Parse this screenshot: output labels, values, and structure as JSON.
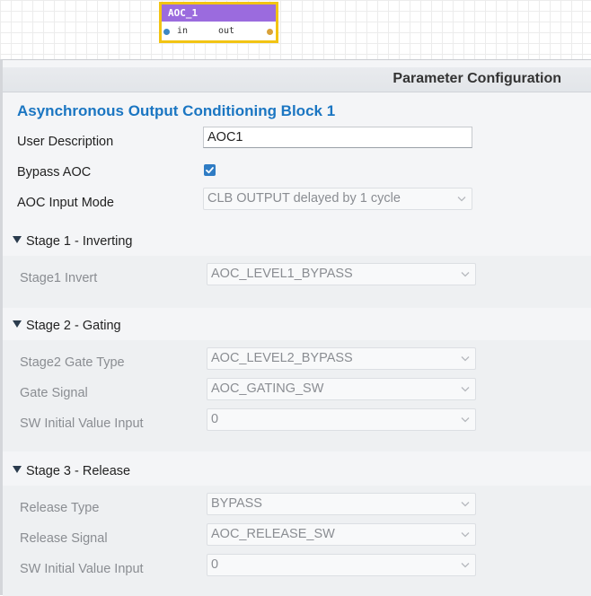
{
  "block": {
    "name": "AOC_1",
    "port_in": "in",
    "port_out": "out"
  },
  "panel": {
    "title": "Parameter Configuration",
    "section_title": "Asynchronous Output Conditioning Block 1",
    "user_description_label": "User Description",
    "user_description_value": "AOC1",
    "bypass_label": "Bypass AOC",
    "bypass_checked": true,
    "input_mode_label": "AOC Input Mode",
    "input_mode_value": "CLB OUTPUT delayed by 1 cycle"
  },
  "stage1": {
    "title": "Stage 1 - Inverting",
    "invert_label": "Stage1 Invert",
    "invert_value": "AOC_LEVEL1_BYPASS"
  },
  "stage2": {
    "title": "Stage 2 - Gating",
    "gate_type_label": "Stage2 Gate Type",
    "gate_type_value": "AOC_LEVEL2_BYPASS",
    "gate_signal_label": "Gate Signal",
    "gate_signal_value": "AOC_GATING_SW",
    "sw_initial_label": "SW Initial Value Input",
    "sw_initial_value": "0"
  },
  "stage3": {
    "title": "Stage 3 - Release",
    "release_type_label": "Release Type",
    "release_type_value": "BYPASS",
    "release_signal_label": "Release Signal",
    "release_signal_value": "AOC_RELEASE_SW",
    "sw_initial_label": "SW Initial Value Input",
    "sw_initial_value": "0"
  },
  "colors": {
    "block_header": "#9b6bde",
    "block_border": "#f2c413",
    "section_title": "#1b76c2",
    "checkbox": "#2f7cc4"
  }
}
